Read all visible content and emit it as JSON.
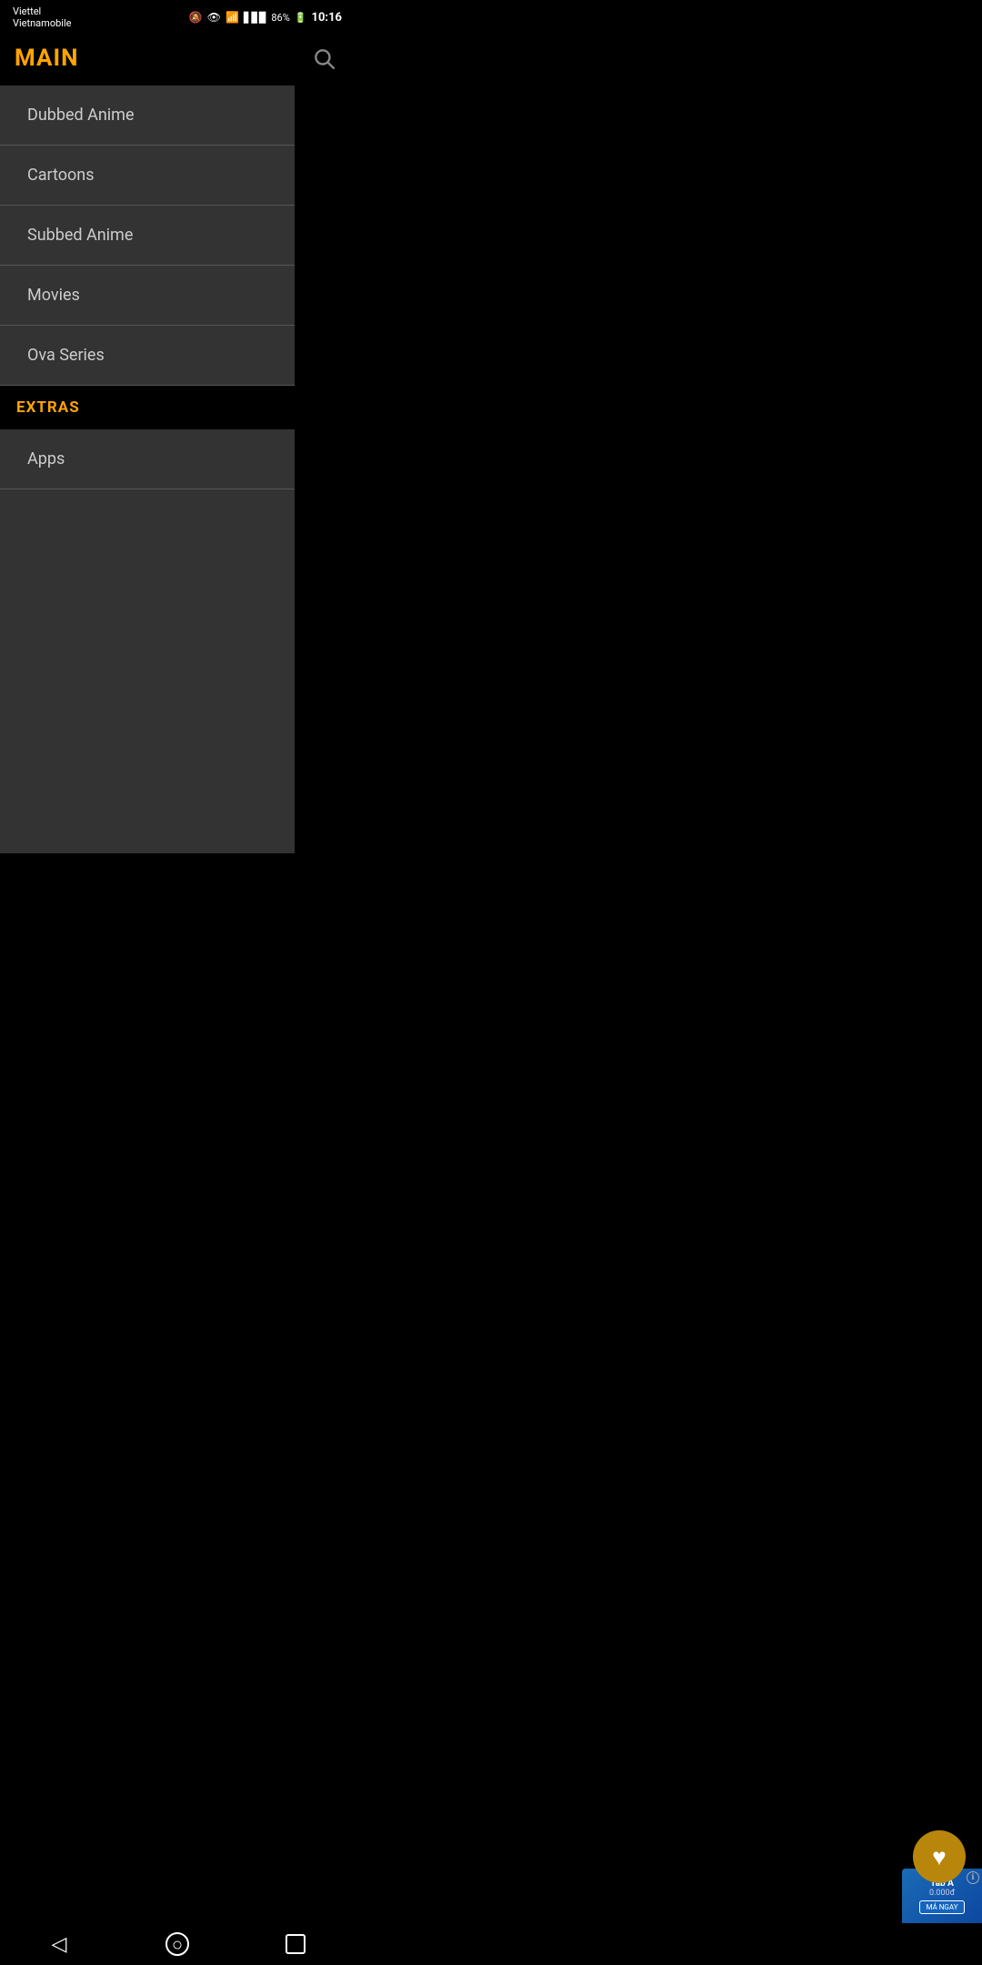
{
  "status": {
    "carrier": "Viettel",
    "carrier2": "Vietnamobile",
    "time": "10:16",
    "battery": "86%"
  },
  "header": {
    "title": "MAIN",
    "search_label": "Search"
  },
  "main_section": {
    "label": "MAIN",
    "items": [
      {
        "id": "dubbed-anime",
        "label": "Dubbed Anime"
      },
      {
        "id": "cartoons",
        "label": "Cartoons"
      },
      {
        "id": "subbed-anime",
        "label": "Subbed Anime"
      },
      {
        "id": "movies",
        "label": "Movies"
      },
      {
        "id": "ova-series",
        "label": "Ova Series"
      }
    ]
  },
  "extras_section": {
    "label": "EXTRAS",
    "items": [
      {
        "id": "apps",
        "label": "Apps"
      }
    ]
  },
  "fab": {
    "label": "Favorites"
  },
  "ad": {
    "line1": "Tab A",
    "line2": "0.000đ",
    "btn": "MÁ NGAY"
  },
  "nav": {
    "back_label": "Back",
    "home_label": "Home",
    "recents_label": "Recents"
  }
}
